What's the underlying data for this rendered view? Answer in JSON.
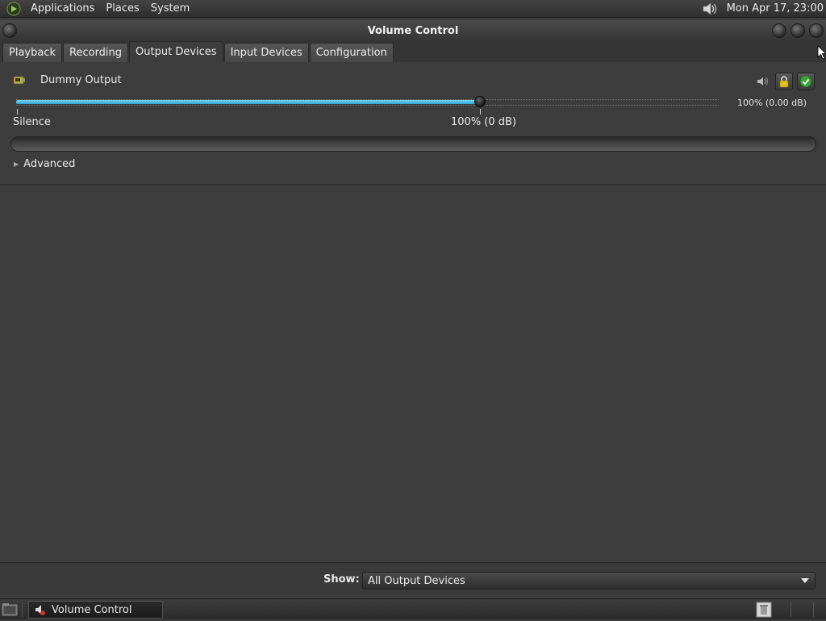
{
  "top_panel": {
    "menus": [
      "Applications",
      "Places",
      "System"
    ],
    "clock": "Mon Apr 17, 23:00",
    "tray_icon": "volume-icon"
  },
  "window": {
    "title": "Volume Control",
    "tabs": [
      "Playback",
      "Recording",
      "Output Devices",
      "Input Devices",
      "Configuration"
    ],
    "active_tab": "Output Devices"
  },
  "device": {
    "name": "Dummy Output",
    "volume_readout": "100% (0.00 dB)",
    "volume_fraction": 0.66,
    "mark_silence": "Silence",
    "mark_100": "100% (0 dB)",
    "advanced_label": "Advanced",
    "lock_state": "locked",
    "default_state": "set"
  },
  "show_bar": {
    "label": "Show:",
    "value": "All Output Devices"
  },
  "taskbar": {
    "task_label": "Volume Control"
  },
  "colors": {
    "accent": "#2aa7d7",
    "background": "#3d3d3d"
  }
}
